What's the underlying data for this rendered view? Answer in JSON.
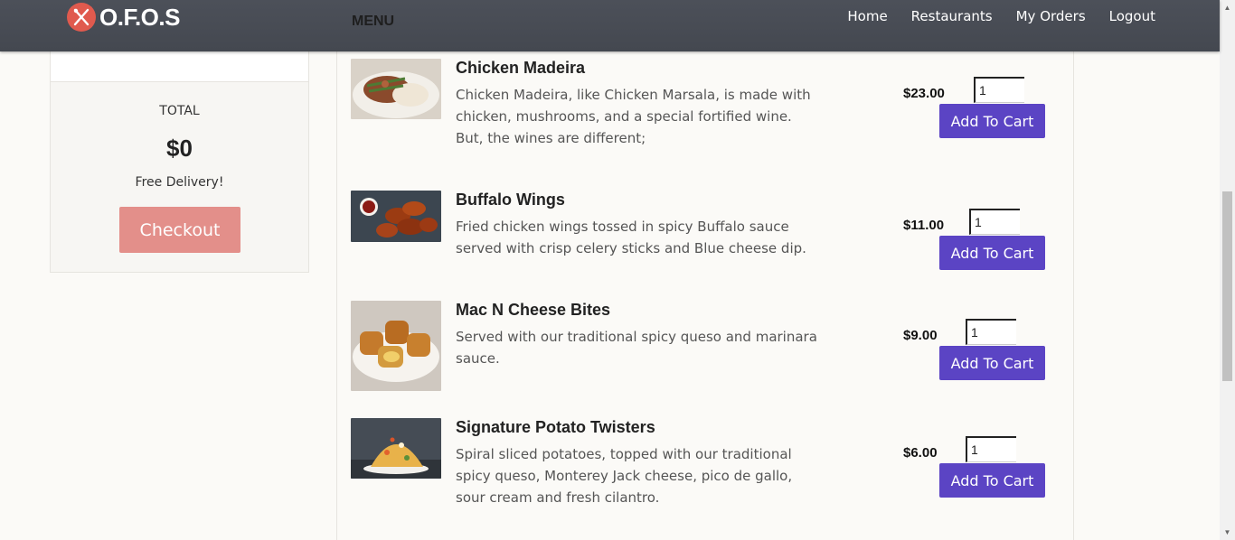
{
  "header": {
    "brand": "O.F.O.S",
    "menu_label": "MENU",
    "nav": [
      "Home",
      "Restaurants",
      "My Orders",
      "Logout"
    ]
  },
  "cart": {
    "total_label": "TOTAL",
    "total_value": "$0",
    "delivery_note": "Free Delivery!",
    "checkout_label": "Checkout"
  },
  "menu_items": [
    {
      "title": "Chicken Madeira",
      "description": "Chicken Madeira, like Chicken Marsala, is made with chicken, mushrooms, and a special fortified wine. But, the wines are different;",
      "price": "$23.00",
      "quantity": "1",
      "button": "Add To Cart"
    },
    {
      "title": "Buffalo Wings",
      "description": "Fried chicken wings tossed in spicy Buffalo sauce served with crisp celery sticks and Blue cheese dip.",
      "price": "$11.00",
      "quantity": "1",
      "button": "Add To Cart"
    },
    {
      "title": "Mac N Cheese Bites",
      "description": "Served with our traditional spicy queso and marinara sauce.",
      "price": "$9.00",
      "quantity": "1",
      "button": "Add To Cart"
    },
    {
      "title": "Signature Potato Twisters",
      "description": "Spiral sliced potatoes, topped with our traditional spicy queso, Monterey Jack cheese, pico de gallo, sour cream and fresh cilantro.",
      "price": "$6.00",
      "quantity": "1",
      "button": "Add To Cart"
    }
  ],
  "colors": {
    "header_bg": "#4a4e57",
    "checkout_bg": "#e38f8a",
    "add_button_bg": "#5b44c4",
    "logo_bg": "#e05a4e"
  },
  "icons": [
    "utensils-logo-icon",
    "chevron-up-icon",
    "chevron-down-icon"
  ]
}
